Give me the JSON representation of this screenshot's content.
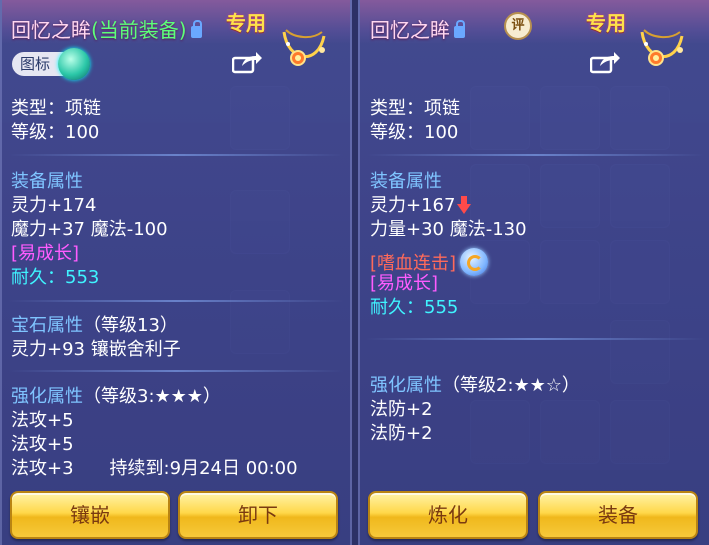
{
  "left": {
    "title_name": "回忆之眸",
    "title_status": "(当前装备)",
    "exclusive_tag": "专用",
    "emblem_label": "图标",
    "type_line": "类型：项链",
    "level_line": "等级：100",
    "equip_attr_head": "装备属性",
    "equip_attr_1": "灵力+174",
    "equip_attr_2": "魔力+37 魔法-100",
    "special_tag": "[易成长]",
    "durability": "耐久：553",
    "gem_head": "宝石属性",
    "gem_level": "（等级13）",
    "gem_attr": "灵力+93 镶嵌舍利子",
    "enhance_head": "强化属性",
    "enhance_level": "（等级3:★★★）",
    "enhance_1": "法攻+5",
    "enhance_2": "法攻+5",
    "enhance_3": "法攻+3",
    "duration": "持续到:9月24日 00:00",
    "btn_1": "镶嵌",
    "btn_2": "卸下"
  },
  "right": {
    "title_name": "回忆之眸",
    "ping_label": "评",
    "exclusive_tag": "专用",
    "type_line": "类型：项链",
    "level_line": "等级：100",
    "equip_attr_head": "装备属性",
    "equip_attr_1": "灵力+167",
    "equip_attr_2": "力量+30 魔法-130",
    "skill_tag": "[嗜血连击]",
    "special_tag": "[易成长]",
    "durability": "耐久：555",
    "enhance_head": "强化属性",
    "enhance_level": "（等级2:★★☆）",
    "enhance_1": "法防+2",
    "enhance_2": "法防+2",
    "btn_1": "炼化",
    "btn_2": "装备"
  },
  "icons": [
    "lock-icon",
    "necklace-icon",
    "share-icon",
    "emblem-orb-icon",
    "ping-icon",
    "arrow-down-icon",
    "refresh-icon"
  ],
  "colors": {
    "panel": "#464e96",
    "section": "#7fc4ff",
    "pink": "#ff5cff",
    "cyan": "#3ff4ff",
    "green": "#5cff7a",
    "gold_button": "#ffd84a"
  }
}
